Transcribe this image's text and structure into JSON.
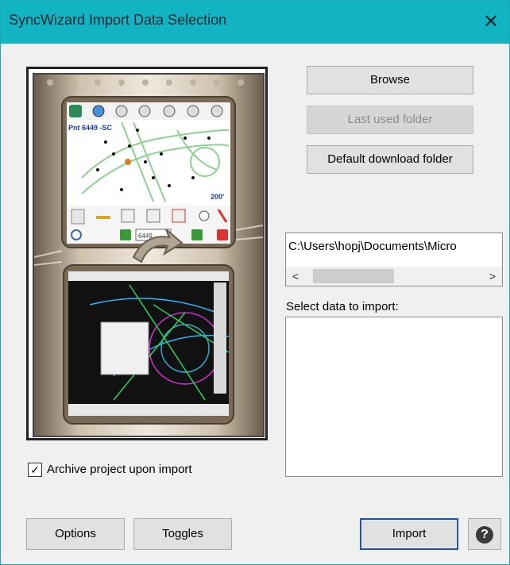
{
  "window": {
    "title": "SyncWizard Import Data Selection",
    "close_glyph": "✕"
  },
  "buttons": {
    "browse": "Browse",
    "last_used_folder": "Last used folder",
    "default_download_folder": "Default download folder",
    "options": "Options",
    "toggles": "Toggles",
    "import": "Import"
  },
  "path": {
    "value": "C:\\Users\\hopj\\Documents\\Micro"
  },
  "scroll": {
    "left_glyph": "<",
    "right_glyph": ">"
  },
  "data_list": {
    "label": "Select data to import:",
    "items": []
  },
  "archive": {
    "label": "Archive project upon import",
    "checked": true,
    "check_glyph": "✓"
  },
  "preview": {
    "point_label": "Pnt 6449 -SC",
    "distance_label": "200'",
    "field_value": "6449"
  },
  "help": {
    "glyph": "?"
  },
  "colors": {
    "titlebar": "#12b4c4",
    "default_button_border": "#1a4fd0"
  }
}
